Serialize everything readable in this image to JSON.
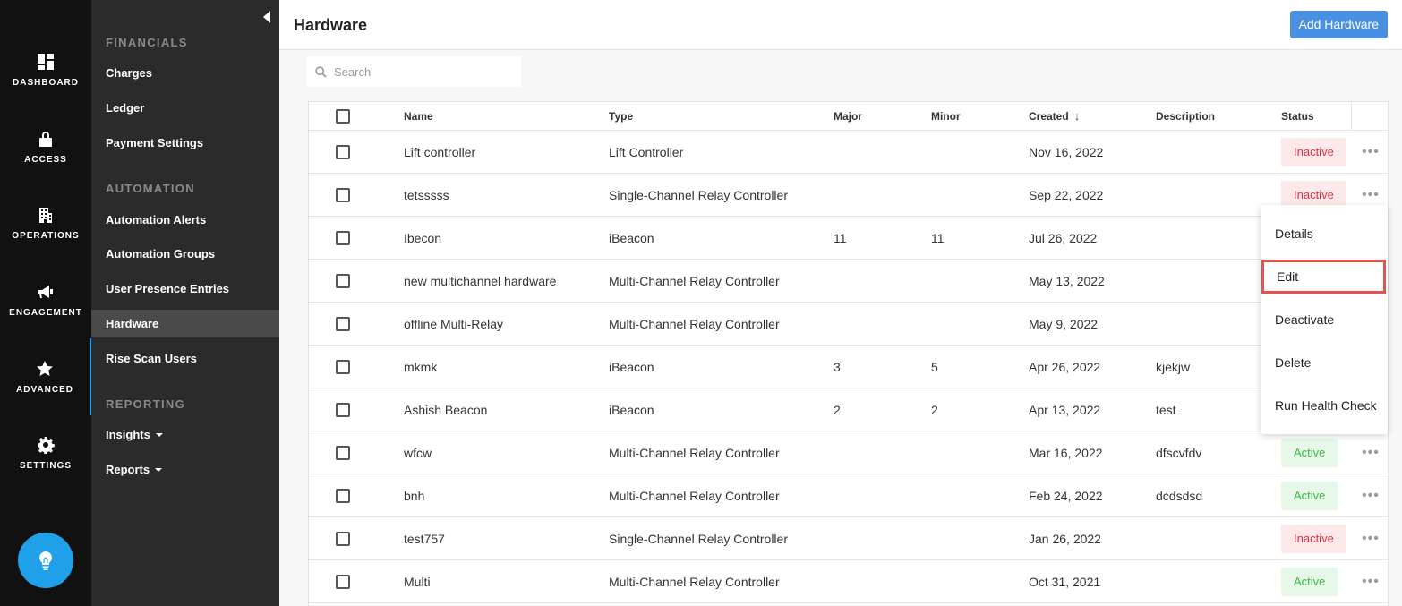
{
  "rail": {
    "items": [
      {
        "label": "DASHBOARD",
        "icon": "dashboard-icon"
      },
      {
        "label": "ACCESS",
        "icon": "lock-icon"
      },
      {
        "label": "OPERATIONS",
        "icon": "building-icon"
      },
      {
        "label": "ENGAGEMENT",
        "icon": "megaphone-icon"
      },
      {
        "label": "ADVANCED",
        "icon": "star-icon",
        "active": true
      },
      {
        "label": "SETTINGS",
        "icon": "gear-icon"
      }
    ],
    "help_icon": "lightbulb-icon"
  },
  "sidebar": {
    "sections": [
      {
        "title": "FINANCIALS",
        "items": [
          "Charges",
          "Ledger",
          "Payment Settings"
        ]
      },
      {
        "title": "AUTOMATION",
        "items": [
          "Automation Alerts",
          "Automation Groups",
          "User Presence Entries",
          "Hardware",
          "Rise Scan Users"
        ]
      },
      {
        "title": "REPORTING",
        "items": [
          "Insights",
          "Reports"
        ]
      }
    ],
    "active_item": "Hardware"
  },
  "header": {
    "title": "Hardware",
    "add_button": "Add Hardware"
  },
  "search": {
    "placeholder": "Search"
  },
  "table": {
    "columns": [
      "Name",
      "Type",
      "Major",
      "Minor",
      "Created",
      "Description",
      "Status"
    ],
    "sorted_by": "Created",
    "sort_direction": "descending",
    "rows": [
      {
        "name": "Lift controller",
        "type": "Lift Controller",
        "major": "",
        "minor": "",
        "created": "Nov 16, 2022",
        "description": "",
        "status": "Inactive"
      },
      {
        "name": "tetsssss",
        "type": "Single-Channel Relay Controller",
        "major": "",
        "minor": "",
        "created": "Sep 22, 2022",
        "description": "",
        "status": "Inactive"
      },
      {
        "name": "Ibecon",
        "type": "iBeacon",
        "major": "11",
        "minor": "11",
        "created": "Jul 26, 2022",
        "description": "",
        "status": ""
      },
      {
        "name": "new multichannel hardware",
        "type": "Multi-Channel Relay Controller",
        "major": "",
        "minor": "",
        "created": "May 13, 2022",
        "description": "",
        "status": ""
      },
      {
        "name": "offline Multi-Relay",
        "type": "Multi-Channel Relay Controller",
        "major": "",
        "minor": "",
        "created": "May 9, 2022",
        "description": "",
        "status": ""
      },
      {
        "name": "mkmk",
        "type": "iBeacon",
        "major": "3",
        "minor": "5",
        "created": "Apr 26, 2022",
        "description": "kjekjw",
        "status": ""
      },
      {
        "name": "Ashish Beacon",
        "type": "iBeacon",
        "major": "2",
        "minor": "2",
        "created": "Apr 13, 2022",
        "description": "test",
        "status": ""
      },
      {
        "name": "wfcw",
        "type": "Multi-Channel Relay Controller",
        "major": "",
        "minor": "",
        "created": "Mar 16, 2022",
        "description": "dfscvfdv",
        "status": "Active"
      },
      {
        "name": "bnh",
        "type": "Multi-Channel Relay Controller",
        "major": "",
        "minor": "",
        "created": "Feb 24, 2022",
        "description": "dcdsdsd",
        "status": "Active"
      },
      {
        "name": "test757",
        "type": "Single-Channel Relay Controller",
        "major": "",
        "minor": "",
        "created": "Jan 26, 2022",
        "description": "",
        "status": "Inactive"
      },
      {
        "name": "Multi",
        "type": "Multi-Channel Relay Controller",
        "major": "",
        "minor": "",
        "created": "Oct 31, 2021",
        "description": "",
        "status": "Active"
      }
    ],
    "row_actions_glyph": "•••"
  },
  "row_menu": {
    "items": [
      "Details",
      "Edit",
      "Deactivate",
      "Delete",
      "Run Health Check"
    ],
    "highlighted": "Edit"
  },
  "colors": {
    "accent": "#4a90e2",
    "rail_active": "#1fa0e8",
    "inactive_text": "#e0324a",
    "inactive_bg": "#fde8ea",
    "active_text": "#3cb848",
    "active_bg": "#e8f8e8",
    "highlight_border": "#e5544a"
  }
}
